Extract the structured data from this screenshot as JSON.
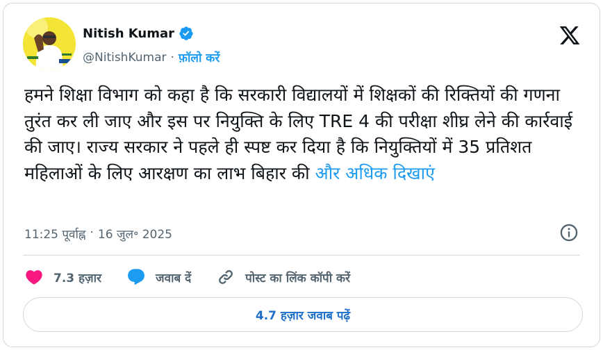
{
  "author": {
    "name": "Nitish Kumar",
    "handle": "@NitishKumar",
    "separator": "·",
    "follow_label": "फ़ॉलो करें"
  },
  "tweet": {
    "text": "हमने शिक्षा विभाग को कहा है कि सरकारी विद्यालयों में शिक्षकों की रिक्तियों की गणना तुरंत कर ली जाए और इस पर नियुक्ति के लिए TRE 4 की परीक्षा शीघ्र लेने की कार्रवाई की जाए। राज्य सरकार ने पहले ही स्पष्ट कर दिया है कि नियुक्तियों में 35 प्रतिशत महिलाओं के लिए आरक्षण का लाभ बिहार की",
    "show_more": "और अधिक दिखाएं",
    "time": "11:25 पूर्वाह्न",
    "meta_separator": "·",
    "date": "16 जुल॰ 2025"
  },
  "actions": {
    "likes": "7.3 हज़ार",
    "reply": "जवाब दें",
    "copy_link": "पोस्ट का लिंक कॉपी करें"
  },
  "read_replies": "4.7 हज़ार जवाब पढ़ें",
  "icons": {
    "verified": "verified-badge-icon",
    "logo": "x-logo-icon",
    "info": "info-icon",
    "like": "heart-icon",
    "reply": "reply-bubble-icon",
    "link": "link-icon"
  },
  "colors": {
    "accent": "#1d9bf0",
    "like": "#f91880",
    "reply": "#1d9bf0",
    "muted": "#536471"
  }
}
